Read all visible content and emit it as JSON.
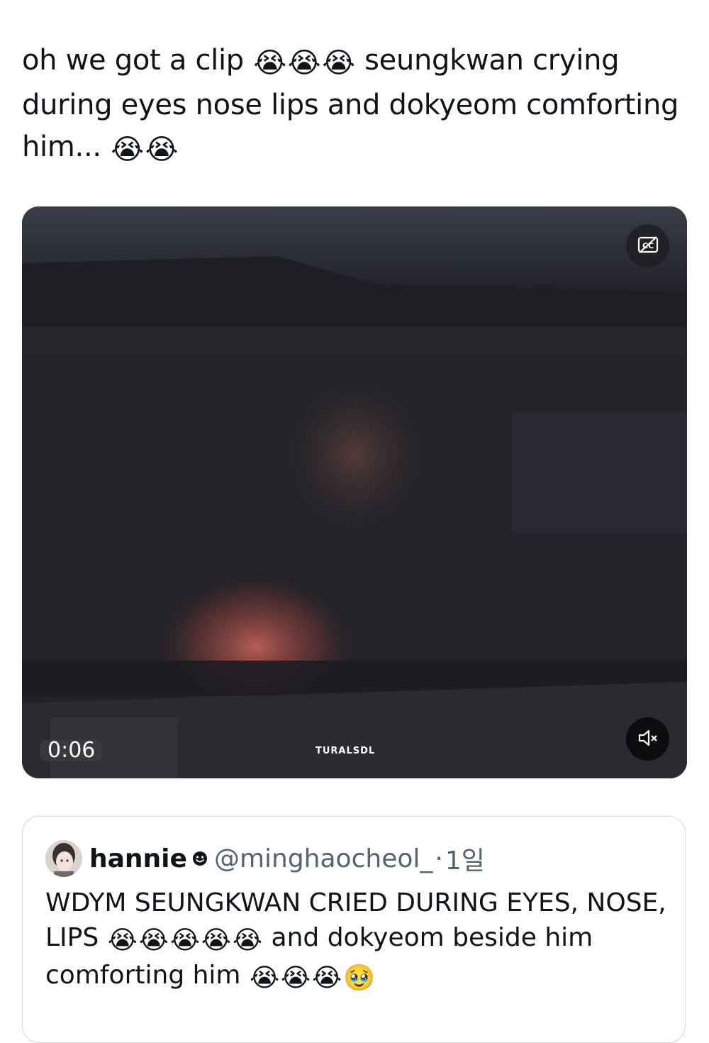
{
  "tweet": {
    "text_part1": "oh we got a clip",
    "emojis_1": [
      "😭",
      "😭",
      "😭"
    ],
    "text_part2": "seungkwan crying during eyes nose lips and dokyeom comforting him...",
    "emojis_2": [
      "😭",
      "😭"
    ]
  },
  "video": {
    "timestamp": "0:06",
    "watermark": "TURALSDL",
    "cc_icon": "captions-off-icon",
    "mute_icon": "speaker-muted-icon"
  },
  "quoted_tweet": {
    "display_name": "hannie",
    "badge_icon": "smiley-face-icon",
    "handle": "@minghaocheol_",
    "separator": "·",
    "time": "1일",
    "text_part1": "WDYM SEUNGKWAN CRIED DURING EYES, NOSE, LIPS",
    "emojis_1": [
      "😭",
      "😭",
      "😭",
      "😭",
      "😭"
    ],
    "text_part2": "and dokyeom beside him comforting him",
    "emojis_2": [
      "😭",
      "😭",
      "😭",
      "🥹"
    ]
  },
  "colors": {
    "text_primary": "#0f1419",
    "text_secondary": "#536471",
    "border": "#cfd9de"
  }
}
